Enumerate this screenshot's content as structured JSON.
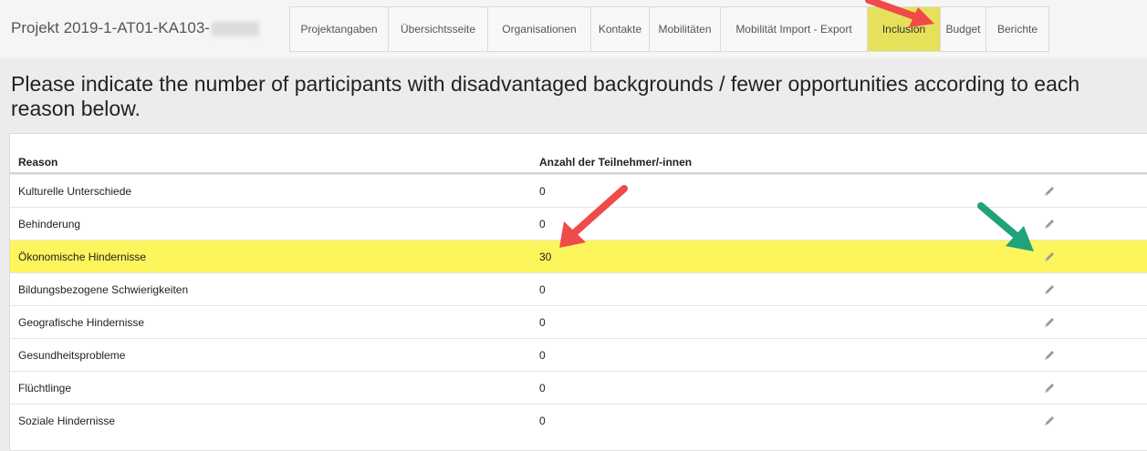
{
  "header": {
    "project_title": "Projekt 2019-1-AT01-KA103-"
  },
  "nav": {
    "tabs": [
      {
        "label": "Projektangaben"
      },
      {
        "label": "Übersichtsseite"
      },
      {
        "label": "Organisationen"
      },
      {
        "label": "Kontakte"
      },
      {
        "label": "Mobilitäten"
      },
      {
        "label": "Mobilität Import - Export"
      },
      {
        "label": "Inclusion",
        "highlighted": true
      },
      {
        "label": "Budget"
      },
      {
        "label": "Berichte"
      }
    ]
  },
  "page": {
    "heading": "Please indicate the number of participants with disadvantaged backgrounds / fewer opportunities according to each reason below."
  },
  "table": {
    "columns": [
      "Reason",
      "Anzahl der Teilnehmer/-innen"
    ],
    "rows": [
      {
        "reason": "Kulturelle Unterschiede",
        "count": "0"
      },
      {
        "reason": "Behinderung",
        "count": "0"
      },
      {
        "reason": "Ökonomische Hindernisse",
        "count": "30",
        "highlighted": true
      },
      {
        "reason": "Bildungsbezogene Schwierigkeiten",
        "count": "0"
      },
      {
        "reason": "Geografische Hindernisse",
        "count": "0"
      },
      {
        "reason": "Gesundheitsprobleme",
        "count": "0"
      },
      {
        "reason": "Flüchtlinge",
        "count": "0"
      },
      {
        "reason": "Soziale Hindernisse",
        "count": "0"
      }
    ],
    "row_action_icon": "pencil-icon"
  },
  "annotations": {
    "highlight_color": "#fdf55c",
    "arrow_red": "#f04a4a",
    "arrow_green": "#1fa37a"
  }
}
